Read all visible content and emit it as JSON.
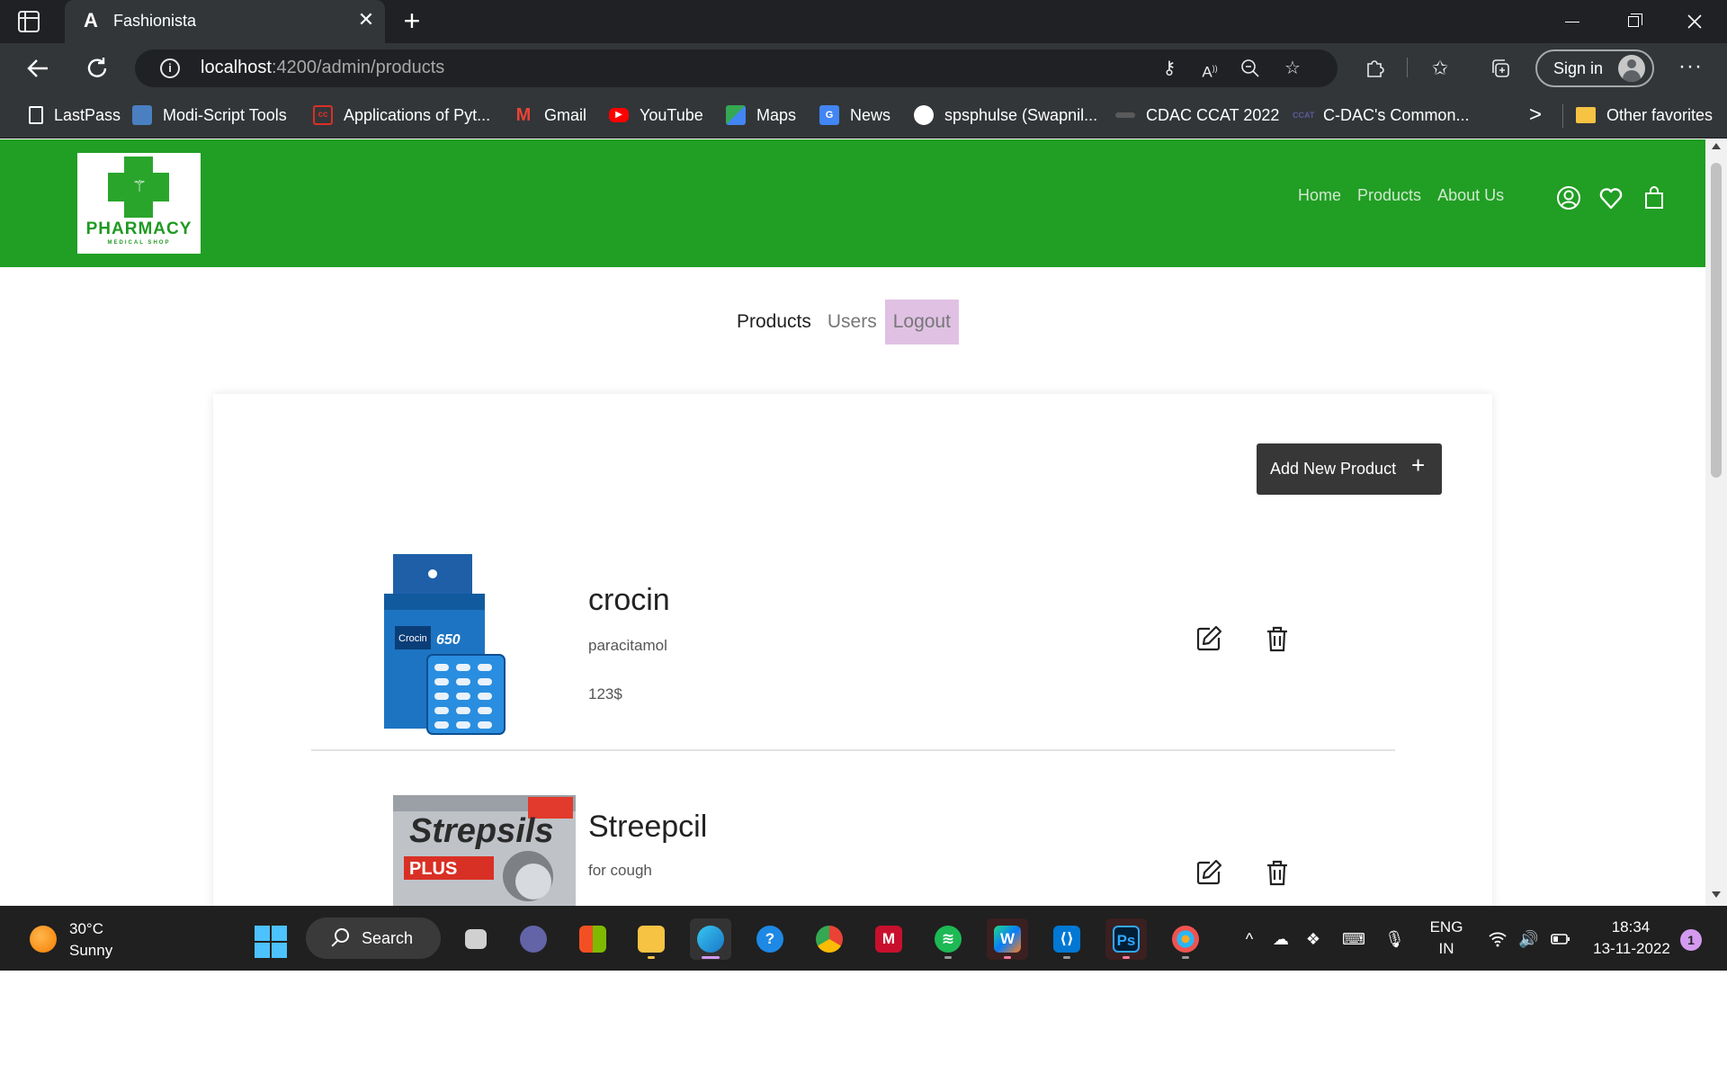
{
  "browser": {
    "tab_title": "Fashionista",
    "tab_favicon": "A",
    "tab_close": "✕",
    "new_tab": "+",
    "url_host": "localhost",
    "url_path": ":4200/admin/products",
    "sign_in": "Sign in",
    "more": "···",
    "bookmarks": [
      {
        "label": "LastPass",
        "icon": "document-icon",
        "color": "#ffffff"
      },
      {
        "label": "Modi-Script Tools",
        "icon": "modi-script-icon",
        "color": "#4a7fc1"
      },
      {
        "label": "Applications of Pyt...",
        "icon": "cc-icon",
        "color": "#d93025"
      },
      {
        "label": "Gmail",
        "icon": "gmail-icon",
        "color": "#ea4335"
      },
      {
        "label": "YouTube",
        "icon": "youtube-icon",
        "color": "#ff0000"
      },
      {
        "label": "Maps",
        "icon": "maps-icon",
        "color": "#34a853"
      },
      {
        "label": "News",
        "icon": "google-news-icon",
        "color": "#4285f4"
      },
      {
        "label": "spsphulse (Swapnil...",
        "icon": "github-icon",
        "color": "#ffffff"
      },
      {
        "label": "CDAC CCAT 2022",
        "icon": "cdac-icon",
        "color": "#8a8a8a"
      },
      {
        "label": "C-DAC's Common...",
        "icon": "ccat-icon",
        "color": "#5a5a9a"
      }
    ],
    "other_favorites": "Other favorites",
    "bookmarks_overflow": ">"
  },
  "site": {
    "logo_title": "PHARMACY",
    "logo_sub": "MEDICAL SHOP",
    "nav": [
      "Home",
      "Products",
      "About Us"
    ],
    "brand_color": "#219e24"
  },
  "admin_nav": {
    "products": "Products",
    "users": "Users",
    "logout": "Logout"
  },
  "products_panel": {
    "add_button": "Add New Product",
    "add_icon": "+",
    "items": [
      {
        "name": "crocin",
        "description": "paracitamol",
        "price": "123$",
        "image": "crocin-pack-image"
      },
      {
        "name": "Streepcil",
        "description": "for cough",
        "price": "",
        "image": "strepsils-pack-image"
      }
    ]
  },
  "product_images": {
    "crocin_brand": "Crocin",
    "crocin_strength": "650",
    "strepsils_brand": "Strepsils",
    "strepsils_variant": "PLUS"
  },
  "taskbar": {
    "weather_temp": "30°C",
    "weather_desc": "Sunny",
    "search_label": "Search",
    "lang_1": "ENG",
    "lang_2": "IN",
    "time": "18:34",
    "date": "13-11-2022",
    "notifications": "1"
  }
}
